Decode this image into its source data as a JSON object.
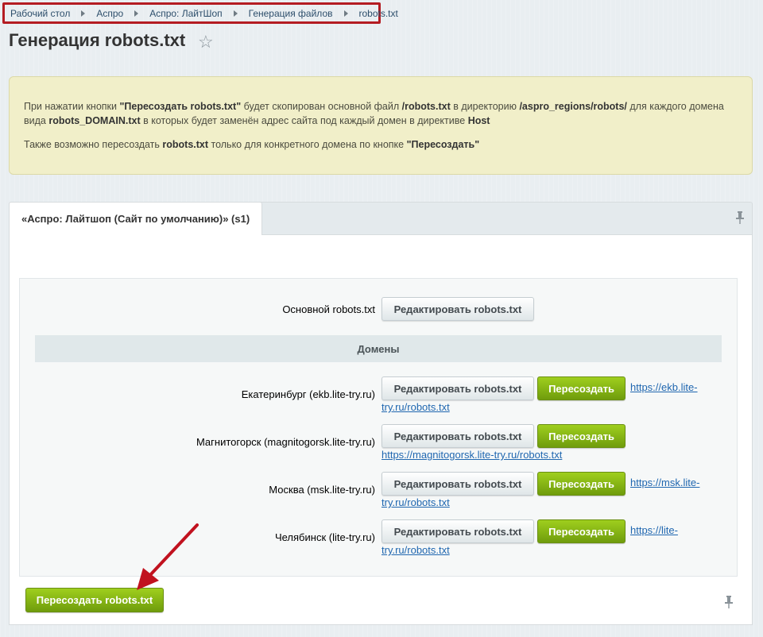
{
  "breadcrumb": {
    "items": [
      "Рабочий стол",
      "Аспро",
      "Аспро: ЛайтШоп",
      "Генерация файлов",
      "robots.txt"
    ]
  },
  "page": {
    "title": "Генерация robots.txt",
    "star_icon": "star-icon"
  },
  "notice": {
    "p1_a": "При нажатии кнопки ",
    "p1_b": "\"Пересоздать robots.txt\"",
    "p1_c": " будет скопирован основной файл ",
    "p1_d": "/robots.txt",
    "p1_e": " в директорию ",
    "p1_f": "/aspro_regions/robots/",
    "p1_g": " для каждого домена вида ",
    "p1_h": "robots_DOMAIN.txt",
    "p1_i": " в которых будет заменён адрес сайта под каждый домен в директиве ",
    "p1_j": "Host",
    "p2_a": "Также возможно пересоздать ",
    "p2_b": "robots.txt",
    "p2_c": " только для конкретного домена по кнопке ",
    "p2_d": "\"Пересоздать\""
  },
  "tab": {
    "label": "«Аспро: Лайтшоп (Сайт по умолчанию)» (s1)"
  },
  "main_robots": {
    "label": "Основной robots.txt",
    "edit_button": "Редактировать robots.txt"
  },
  "domains_header": "Домены",
  "domains": [
    {
      "label": "Екатеринбург (ekb.lite-try.ru)",
      "edit_button": "Редактировать robots.txt",
      "recreate_button": "Пересоздать",
      "link_line1": "https://ekb.lite-",
      "link_line2": "try.ru/robots.txt"
    },
    {
      "label": "Магнитогорск (magnitogorsk.lite-try.ru)",
      "edit_button": "Редактировать robots.txt",
      "recreate_button": "Пересоздать",
      "link_line1": "",
      "link_line2": "https://magnitogorsk.lite-try.ru/robots.txt"
    },
    {
      "label": "Москва (msk.lite-try.ru)",
      "edit_button": "Редактировать robots.txt",
      "recreate_button": "Пересоздать",
      "link_line1": "https://msk.lite-",
      "link_line2": "try.ru/robots.txt"
    },
    {
      "label": "Челябинск (lite-try.ru)",
      "edit_button": "Редактировать robots.txt",
      "recreate_button": "Пересоздать",
      "link_line1": "https://lite-",
      "link_line2": "try.ru/robots.txt"
    }
  ],
  "footer": {
    "recreate_all_button": "Пересоздать robots.txt"
  },
  "colors": {
    "accent_green": "#7fb113",
    "breadcrumb_highlight": "#b41c22",
    "annotation_arrow": "#c1121f",
    "notice_bg": "#f1efc9",
    "link": "#2067b0"
  },
  "icons": [
    "star-icon",
    "pin-icon",
    "arrow-annotation"
  ]
}
